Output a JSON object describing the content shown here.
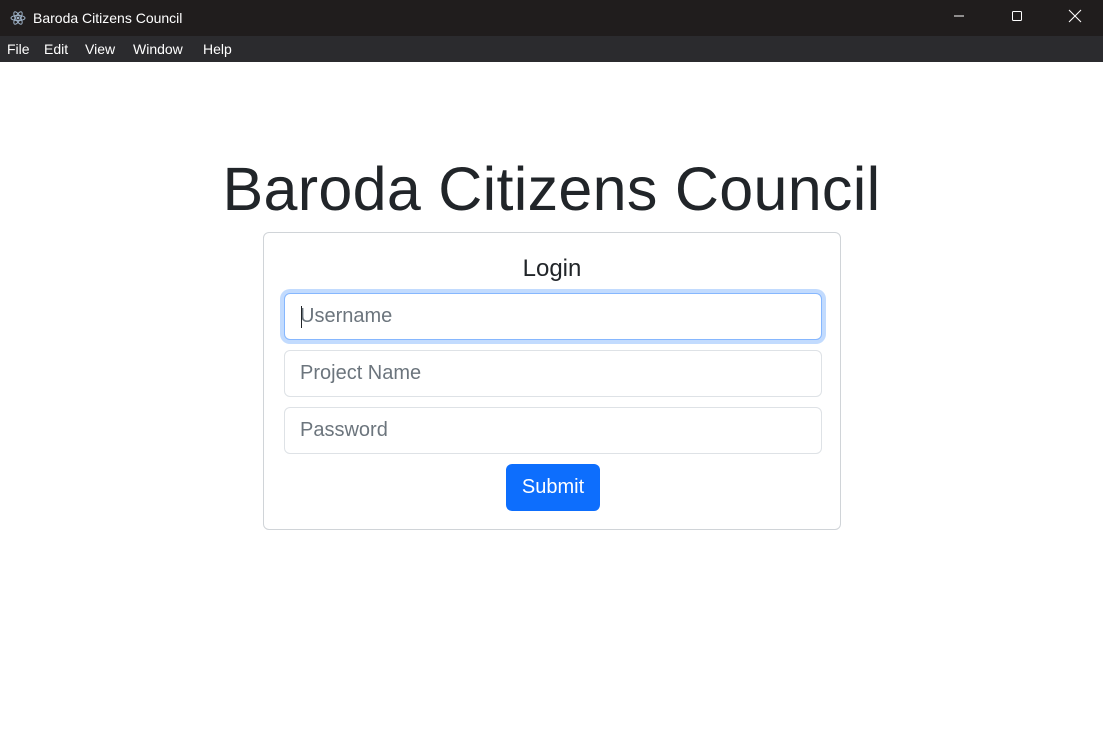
{
  "window": {
    "title": "Baroda Citizens Council",
    "icon": "electron-icon",
    "controls": [
      "minimize-icon",
      "maximize-icon",
      "close-icon"
    ]
  },
  "menubar": {
    "items": [
      {
        "label": "File"
      },
      {
        "label": "Edit"
      },
      {
        "label": "View"
      },
      {
        "label": "Window"
      },
      {
        "label": "Help"
      }
    ]
  },
  "page": {
    "heading": "Baroda Citizens Council"
  },
  "login": {
    "title": "Login",
    "username": {
      "value": "",
      "placeholder": "Username"
    },
    "project_name": {
      "value": "",
      "placeholder": "Project Name"
    },
    "password": {
      "value": "",
      "placeholder": "Password"
    },
    "submit_label": "Submit"
  },
  "colors": {
    "titlebar_bg": "#201d1d",
    "menubar_bg": "#2b2b2e",
    "accent": "#0d6efd",
    "focus_ring": "#86b7fe",
    "text": "#212529"
  }
}
